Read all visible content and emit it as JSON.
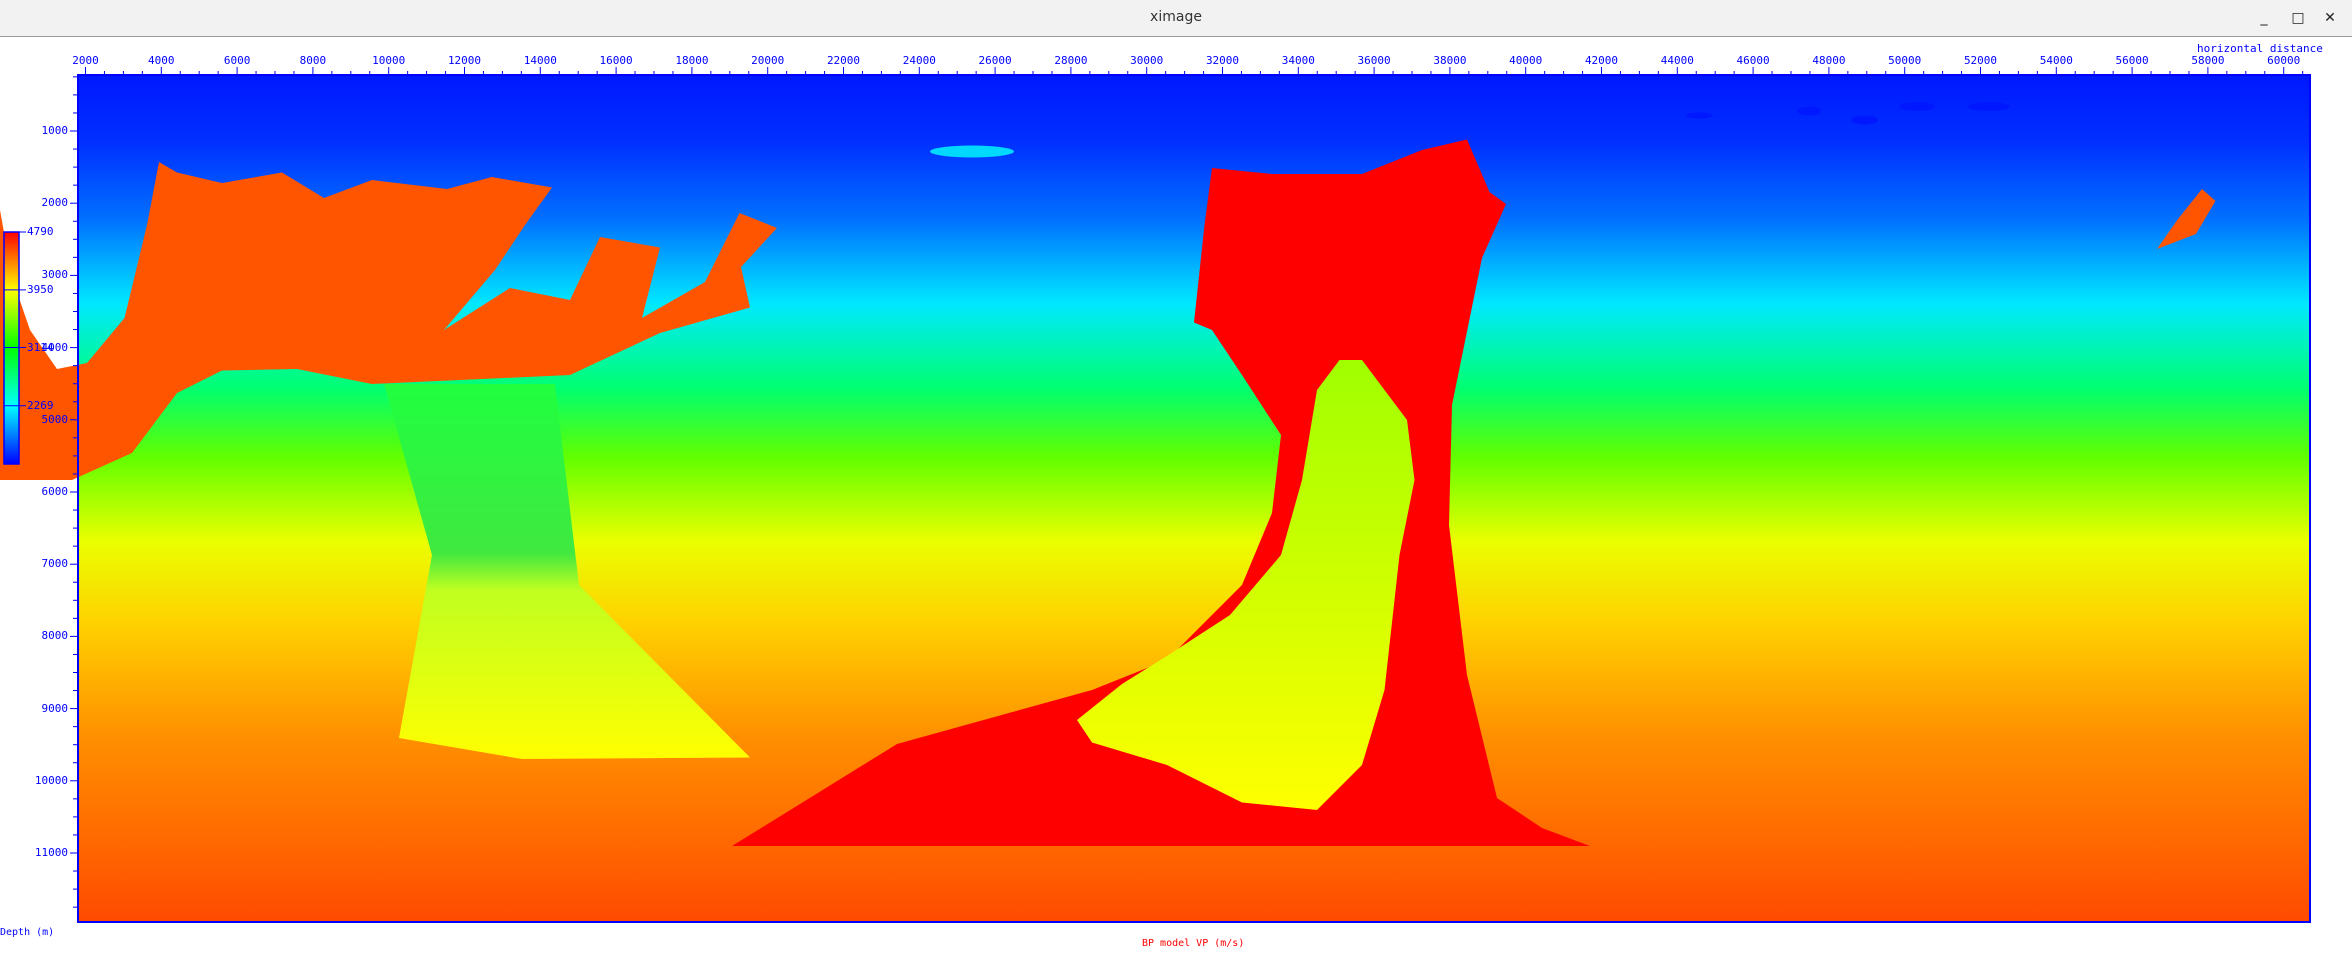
{
  "window": {
    "title": "ximage",
    "minimize": "_",
    "maximize": "□",
    "close": "✕"
  },
  "plot": {
    "title": "BP model VP (m/s)",
    "x_axis_label": "horizontal distance",
    "y_axis_label": "Depth (m)",
    "x_ticks": [
      "2000",
      "4000",
      "6000",
      "8000",
      "10000",
      "12000",
      "14000",
      "16000",
      "18000",
      "20000",
      "22000",
      "24000",
      "26000",
      "28000",
      "30000",
      "32000",
      "34000",
      "36000",
      "38000",
      "40000",
      "42000",
      "44000",
      "46000",
      "48000",
      "50000",
      "52000",
      "54000",
      "56000",
      "58000",
      "60000"
    ],
    "y_ticks": [
      "1000",
      "2000",
      "3000",
      "4000",
      "5000",
      "6000",
      "7000",
      "8000",
      "9000",
      "10000",
      "11000"
    ],
    "colorbar_ticks": [
      "4790",
      "3950",
      "3114",
      "2269"
    ],
    "colorbar_range": [
      1425,
      4790
    ]
  },
  "colors": {
    "axis": "#0000ff",
    "title": "#ff0000",
    "salt_orange": "#ff5500",
    "salt_red": "#ff0000"
  }
}
